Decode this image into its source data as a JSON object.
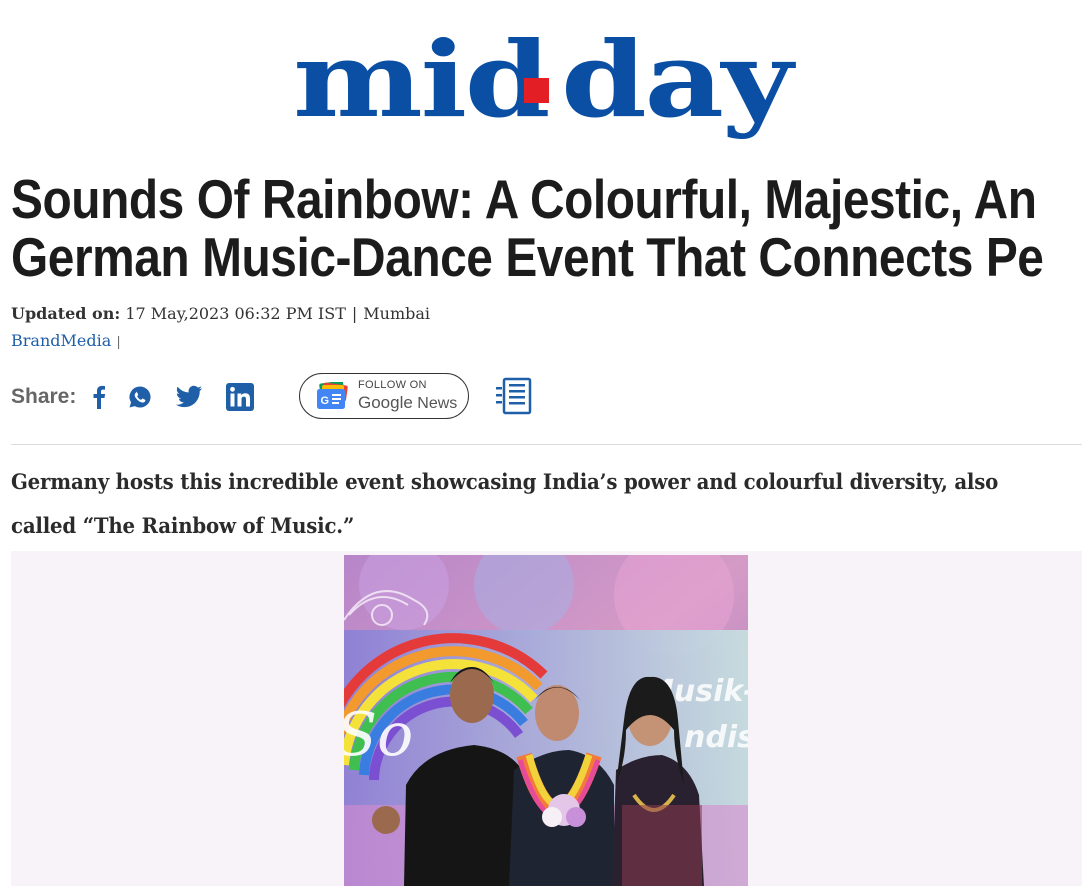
{
  "brand": {
    "logo_text_left": "mid",
    "logo_text_right": "day",
    "logo_color": "#0a4fa3",
    "logo_dot_color": "#e31e24"
  },
  "article": {
    "headline_line1": "Sounds Of Rainbow: A Colourful, Majestic, An",
    "headline_line2": "German Music-Dance Event That Connects Pe",
    "updated_label": "Updated on:",
    "updated_value": "17 May,2023 06:32 PM IST",
    "separator": "|",
    "location": "Mumbai",
    "author": "BrandMedia",
    "author_suffix": "|",
    "standfirst": "Germany hosts this incredible event showcasing India’s power and colourful diversity, also called “The Rainbow of Music.”"
  },
  "share": {
    "label": "Share:",
    "icons": [
      "facebook-icon",
      "whatsapp-icon",
      "twitter-icon",
      "linkedin-icon"
    ],
    "google_news": {
      "follow_label": "FOLLOW ON",
      "google_word": "Google",
      "news_word": "News"
    }
  },
  "hero": {
    "sign_text_1": "Musik-",
    "sign_text_2": "ndis"
  },
  "colors": {
    "link_blue": "#1f5fa8",
    "facebook": "#1f5fa8",
    "whatsapp": "#1f5fa8",
    "twitter": "#1f5fa8",
    "linkedin": "#1f5fa8"
  }
}
